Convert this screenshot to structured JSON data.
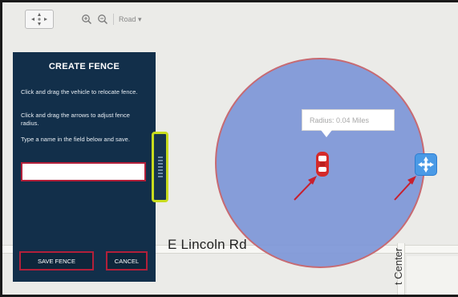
{
  "toolbar": {
    "map_type_label": "Road",
    "icons": [
      "pan-control-icon",
      "zoom-in-icon",
      "zoom-out-icon"
    ]
  },
  "map": {
    "street_horizontal": "E Lincoln Rd",
    "street_vertical": "t Center",
    "fence_tooltip": "Radius: 0.04 Miles",
    "fence_fill_color": "#7d96d7",
    "fence_border_color": "#c76a72",
    "vehicle_color": "#d42a2a",
    "resize_handle_color": "#4a9ae6"
  },
  "panel": {
    "title": "CREATE FENCE",
    "instruction_1": "Click and drag the vehicle to relocate fence.",
    "instruction_2": "Click and drag the arrows to adjust fence radius.",
    "instruction_3": "Type a name in the field below and save.",
    "name_input": {
      "value": "",
      "placeholder": ""
    },
    "save_label": "SAVE FENCE",
    "cancel_label": "CANCEL",
    "background_color": "#122f4a",
    "highlight_color": "#b2203a"
  }
}
